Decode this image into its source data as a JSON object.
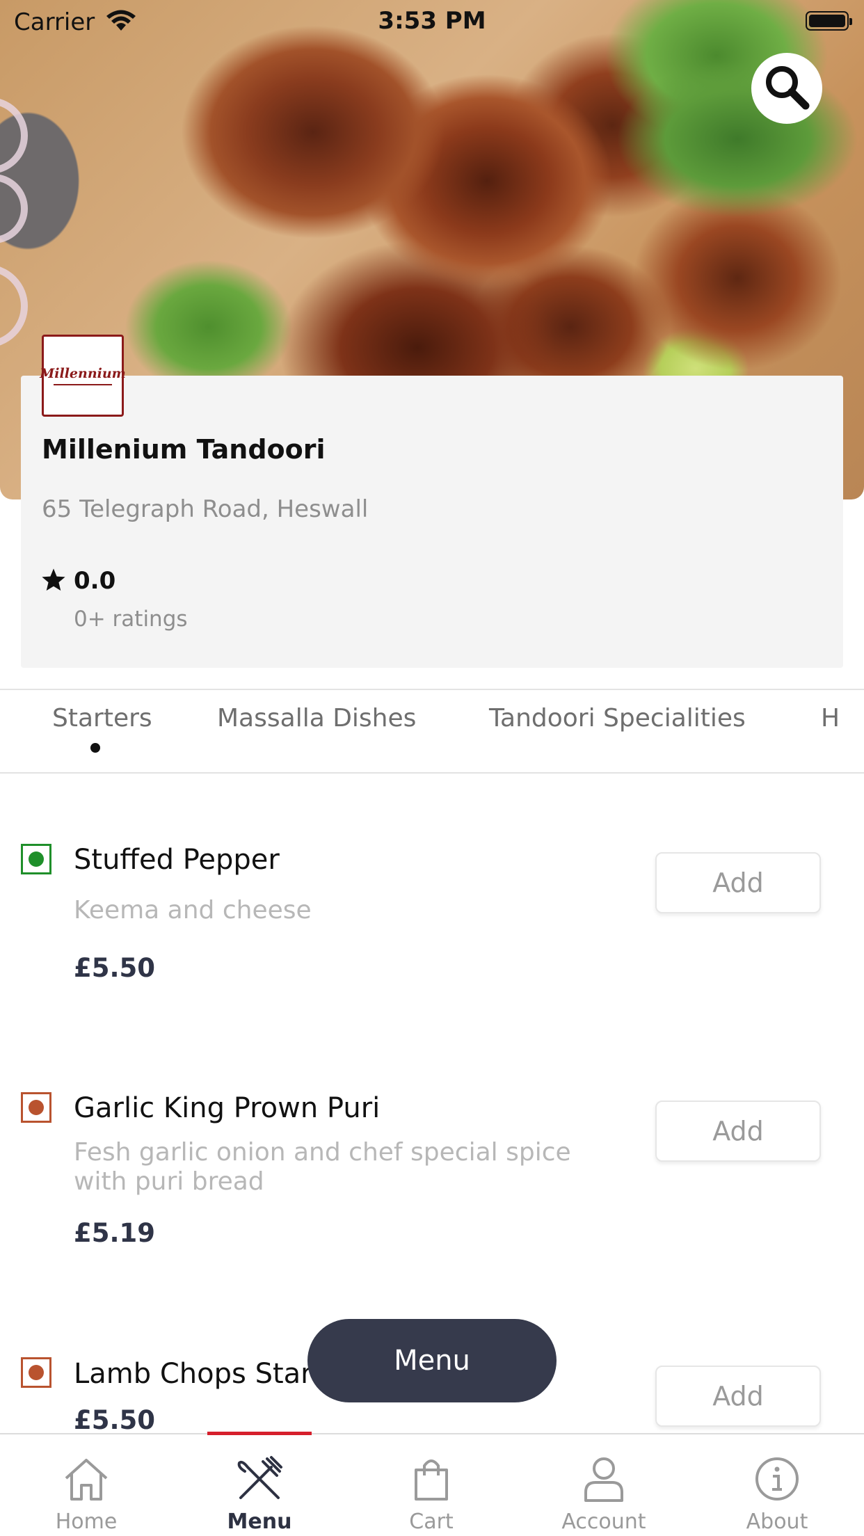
{
  "status_bar": {
    "carrier": "Carrier",
    "time": "3:53 PM"
  },
  "restaurant": {
    "name": "Millenium Tandoori",
    "logo_text": "Millennium",
    "address": "65 Telegraph Road, Heswall",
    "rating": "0.0",
    "ratings_count": "0+ ratings"
  },
  "tabs": [
    {
      "label": "Starters",
      "active": true
    },
    {
      "label": "Massalla Dishes",
      "active": false
    },
    {
      "label": "Tandoori Specialities",
      "active": false
    },
    {
      "label": "H",
      "active": false
    }
  ],
  "items": [
    {
      "name": "Stuffed Pepper",
      "description": "Keema and cheese",
      "price": "£5.50",
      "diet": "veg",
      "add_label": "Add"
    },
    {
      "name": "Garlic King Prown Puri",
      "description": "Fesh garlic onion and chef special spice with puri bread",
      "price": "£5.19",
      "diet": "non-veg",
      "add_label": "Add"
    },
    {
      "name": "Lamb Chops Star",
      "description": "",
      "price": "£5.50",
      "diet": "non-veg",
      "add_label": "Add"
    }
  ],
  "floating_button": {
    "label": "Menu"
  },
  "bottom_nav": [
    {
      "label": "Home",
      "icon": "home-icon",
      "active": false
    },
    {
      "label": "Menu",
      "icon": "fork-knife-icon",
      "active": true
    },
    {
      "label": "Cart",
      "icon": "bag-icon",
      "active": false
    },
    {
      "label": "Account",
      "icon": "person-icon",
      "active": false
    },
    {
      "label": "About",
      "icon": "info-icon",
      "active": false
    }
  ],
  "colors": {
    "veg": "#1f8f2a",
    "non_veg": "#b9532f",
    "accent": "#d61f2c",
    "dark": "#363a4c"
  }
}
